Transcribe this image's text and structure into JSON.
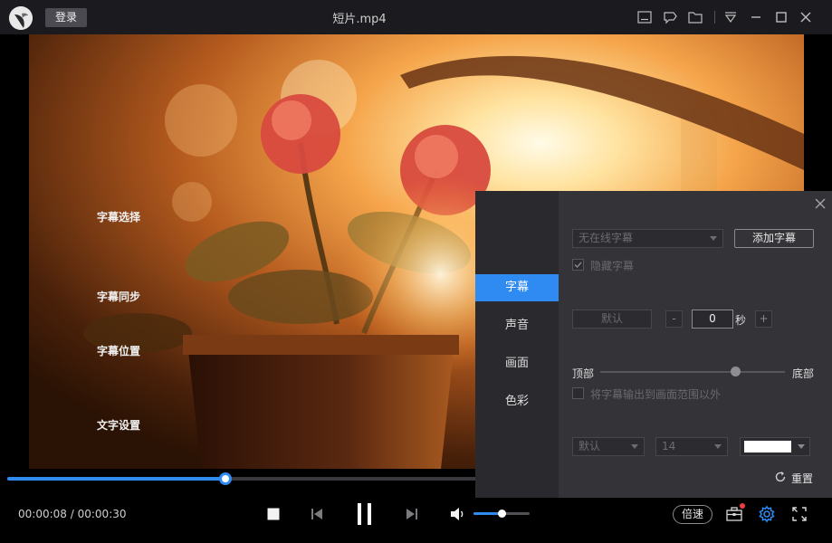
{
  "titlebar": {
    "login_label": "登录",
    "file_title": "短片.mp4",
    "icons": [
      "subtitle-icon",
      "pin-icon",
      "folder-icon",
      "menu-icon",
      "minimize-icon",
      "maximize-icon",
      "close-icon"
    ]
  },
  "player": {
    "current_time": "00:00:08",
    "time_separator": "/",
    "total_time": "00:00:30",
    "progress": 0.267,
    "volume": 0.5,
    "speed_label": "倍速",
    "accent_color": "#2f8bf2"
  },
  "settings_panel": {
    "tabs": [
      {
        "label": "字幕",
        "active": true
      },
      {
        "label": "声音",
        "active": false
      },
      {
        "label": "画面",
        "active": false
      },
      {
        "label": "色彩",
        "active": false
      }
    ],
    "subtitle_select": {
      "title": "字幕选择",
      "dropdown_value": "无在线字幕",
      "add_button": "添加字幕",
      "hide_label": "隐藏字幕",
      "hide_checked": true
    },
    "subtitle_sync": {
      "title": "字幕同步",
      "default_button": "默认",
      "minus": "-",
      "value": "0",
      "unit": "秒",
      "plus": "+"
    },
    "subtitle_position": {
      "title": "字幕位置",
      "top_label": "顶部",
      "bottom_label": "底部",
      "slider_value": 0.73,
      "overflow_label": "将字幕输出到画面范围以外",
      "overflow_checked": false
    },
    "text_settings": {
      "title": "文字设置",
      "font_value": "默认",
      "size_value": "14",
      "color_value": "#ffffff"
    },
    "reset_label": "重置"
  }
}
